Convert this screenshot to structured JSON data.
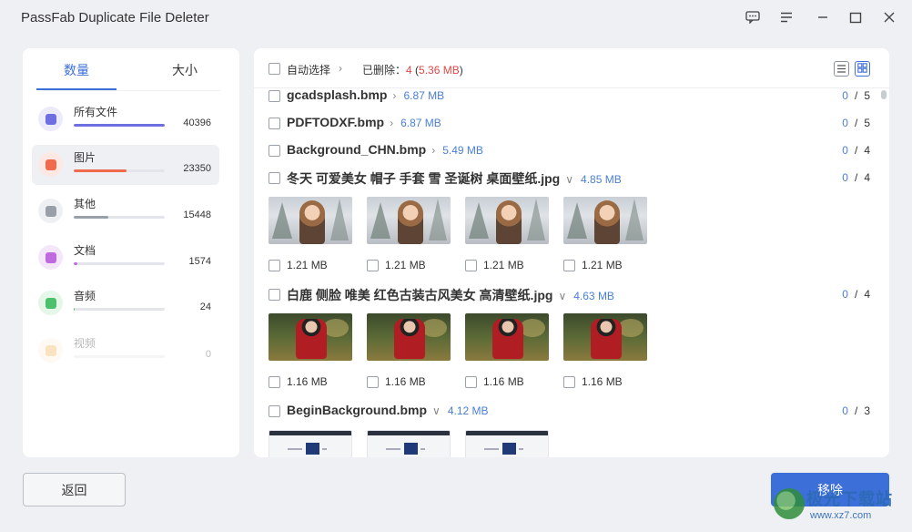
{
  "window": {
    "title": "PassFab Duplicate File Deleter"
  },
  "sidebar": {
    "tabs": [
      {
        "label": "数量",
        "active": true
      },
      {
        "label": "大小",
        "active": false
      }
    ],
    "categories": [
      {
        "label": "所有文件",
        "count": "40396",
        "icon": "all-files-icon",
        "color": "#6d6fe0",
        "bg": "#ecebfb",
        "progress": 1.0,
        "active": false
      },
      {
        "label": "图片",
        "count": "23350",
        "icon": "image-icon",
        "color": "#f06a4d",
        "bg": "#fde8e3",
        "progress": 0.58,
        "active": true
      },
      {
        "label": "其他",
        "count": "15448",
        "icon": "grid-icon",
        "color": "#9aa0aa",
        "bg": "#eef0f3",
        "progress": 0.38,
        "active": false
      },
      {
        "label": "文档",
        "count": "1574",
        "icon": "document-icon",
        "color": "#c06ae0",
        "bg": "#f5e7fb",
        "progress": 0.04,
        "active": false
      },
      {
        "label": "音频",
        "count": "24",
        "icon": "microphone-icon",
        "color": "#4cc06a",
        "bg": "#e5f7e9",
        "progress": 0.01,
        "active": false
      },
      {
        "label": "视频",
        "count": "0",
        "icon": "video-icon",
        "color": "#f0b04d",
        "bg": "#fdf1de",
        "progress": 0.0,
        "active": false,
        "disabled": true
      }
    ]
  },
  "toolbar": {
    "auto_select": "自动选择",
    "chevron": "›",
    "deleted_label": "已删除：",
    "deleted_count": "4",
    "deleted_size": "5.36 MB",
    "paren_open": " (",
    "paren_close": ")"
  },
  "groups": [
    {
      "name": "gcadsplash.bmp",
      "size": "6.87 MB",
      "selected": "0",
      "total": "5",
      "expanded": false
    },
    {
      "name": "PDFTODXF.bmp",
      "size": "6.87 MB",
      "selected": "0",
      "total": "5",
      "expanded": false
    },
    {
      "name": "Background_CHN.bmp",
      "size": "5.49 MB",
      "selected": "0",
      "total": "4",
      "expanded": false
    },
    {
      "name": "冬天 可爱美女 帽子 手套 雪 圣诞树 桌面壁纸.jpg",
      "size": "4.85 MB",
      "selected": "0",
      "total": "4",
      "expanded": true,
      "thumb_style": "winter",
      "file_size": "1.21 MB",
      "files": 4
    },
    {
      "name": "白鹿 侧脸 唯美 红色古装古风美女 高清壁纸.jpg",
      "size": "4.63 MB",
      "selected": "0",
      "total": "4",
      "expanded": true,
      "thumb_style": "red",
      "file_size": "1.16 MB",
      "files": 4
    },
    {
      "name": "BeginBackground.bmp",
      "size": "4.12 MB",
      "selected": "0",
      "total": "3",
      "expanded": true,
      "thumb_style": "ui",
      "files": 3
    }
  ],
  "count_separator": "/",
  "footer": {
    "back_label": "返回",
    "remove_label": "移除"
  },
  "watermark": {
    "text": "极光下载站",
    "url": "www.xz7.com"
  }
}
